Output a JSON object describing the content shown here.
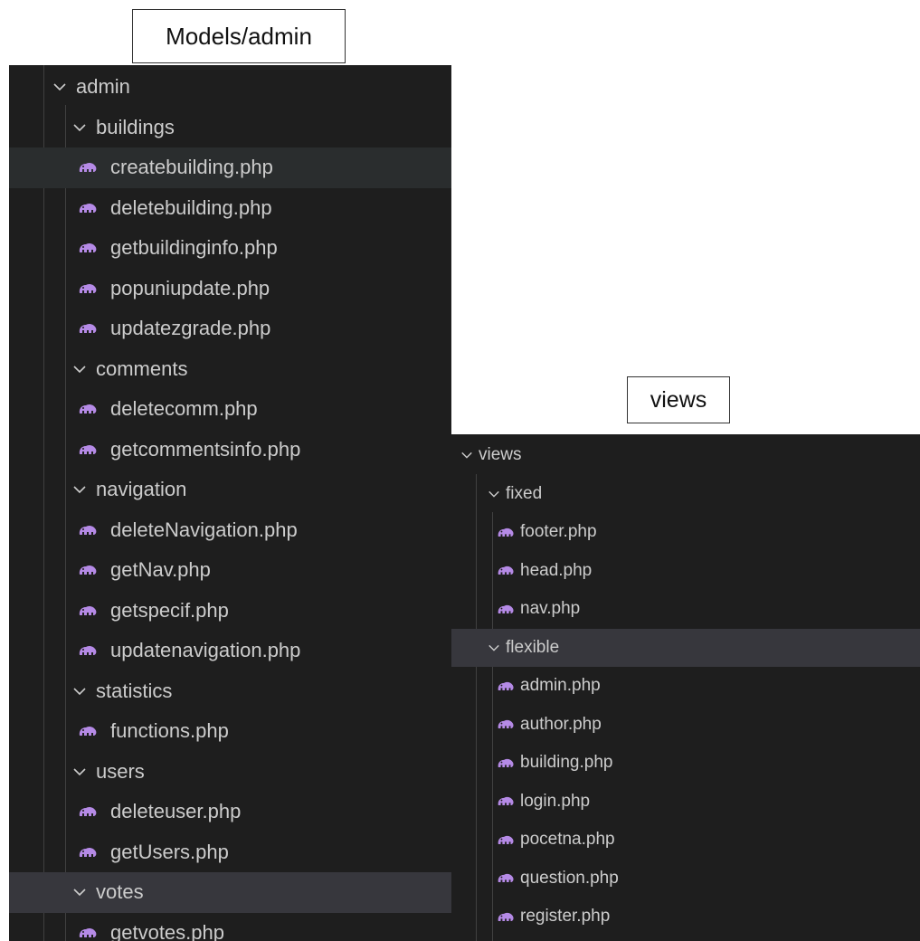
{
  "captions": {
    "left": "Models/admin",
    "right": "views"
  },
  "colors": {
    "panel_bg": "#1e1e1e",
    "text": "#cccccc",
    "php_icon": "#b58ae6",
    "hover_row": "#2a2d2e",
    "selected_row": "#37373d"
  },
  "icons": {
    "folder_expanded": "chevron-down-icon",
    "php_file": "php-elephant-icon"
  },
  "models_tree": {
    "root": "admin",
    "folders": [
      {
        "name": "buildings",
        "files": [
          "createbuilding.php",
          "deletebuilding.php",
          "getbuildinginfo.php",
          "popuniupdate.php",
          "updatezgrade.php"
        ]
      },
      {
        "name": "comments",
        "files": [
          "deletecomm.php",
          "getcommentsinfo.php"
        ]
      },
      {
        "name": "navigation",
        "files": [
          "deleteNavigation.php",
          "getNav.php",
          "getspecif.php",
          "updatenavigation.php"
        ]
      },
      {
        "name": "statistics",
        "files": [
          "functions.php"
        ]
      },
      {
        "name": "users",
        "files": [
          "deleteuser.php",
          "getUsers.php"
        ]
      },
      {
        "name": "votes",
        "files": [
          "getvotes.php"
        ]
      }
    ]
  },
  "views_tree": {
    "root": "views",
    "folders": [
      {
        "name": "fixed",
        "files": [
          "footer.php",
          "head.php",
          "nav.php"
        ]
      },
      {
        "name": "flexible",
        "files": [
          "admin.php",
          "author.php",
          "building.php",
          "login.php",
          "pocetna.php",
          "question.php",
          "register.php"
        ]
      }
    ]
  }
}
